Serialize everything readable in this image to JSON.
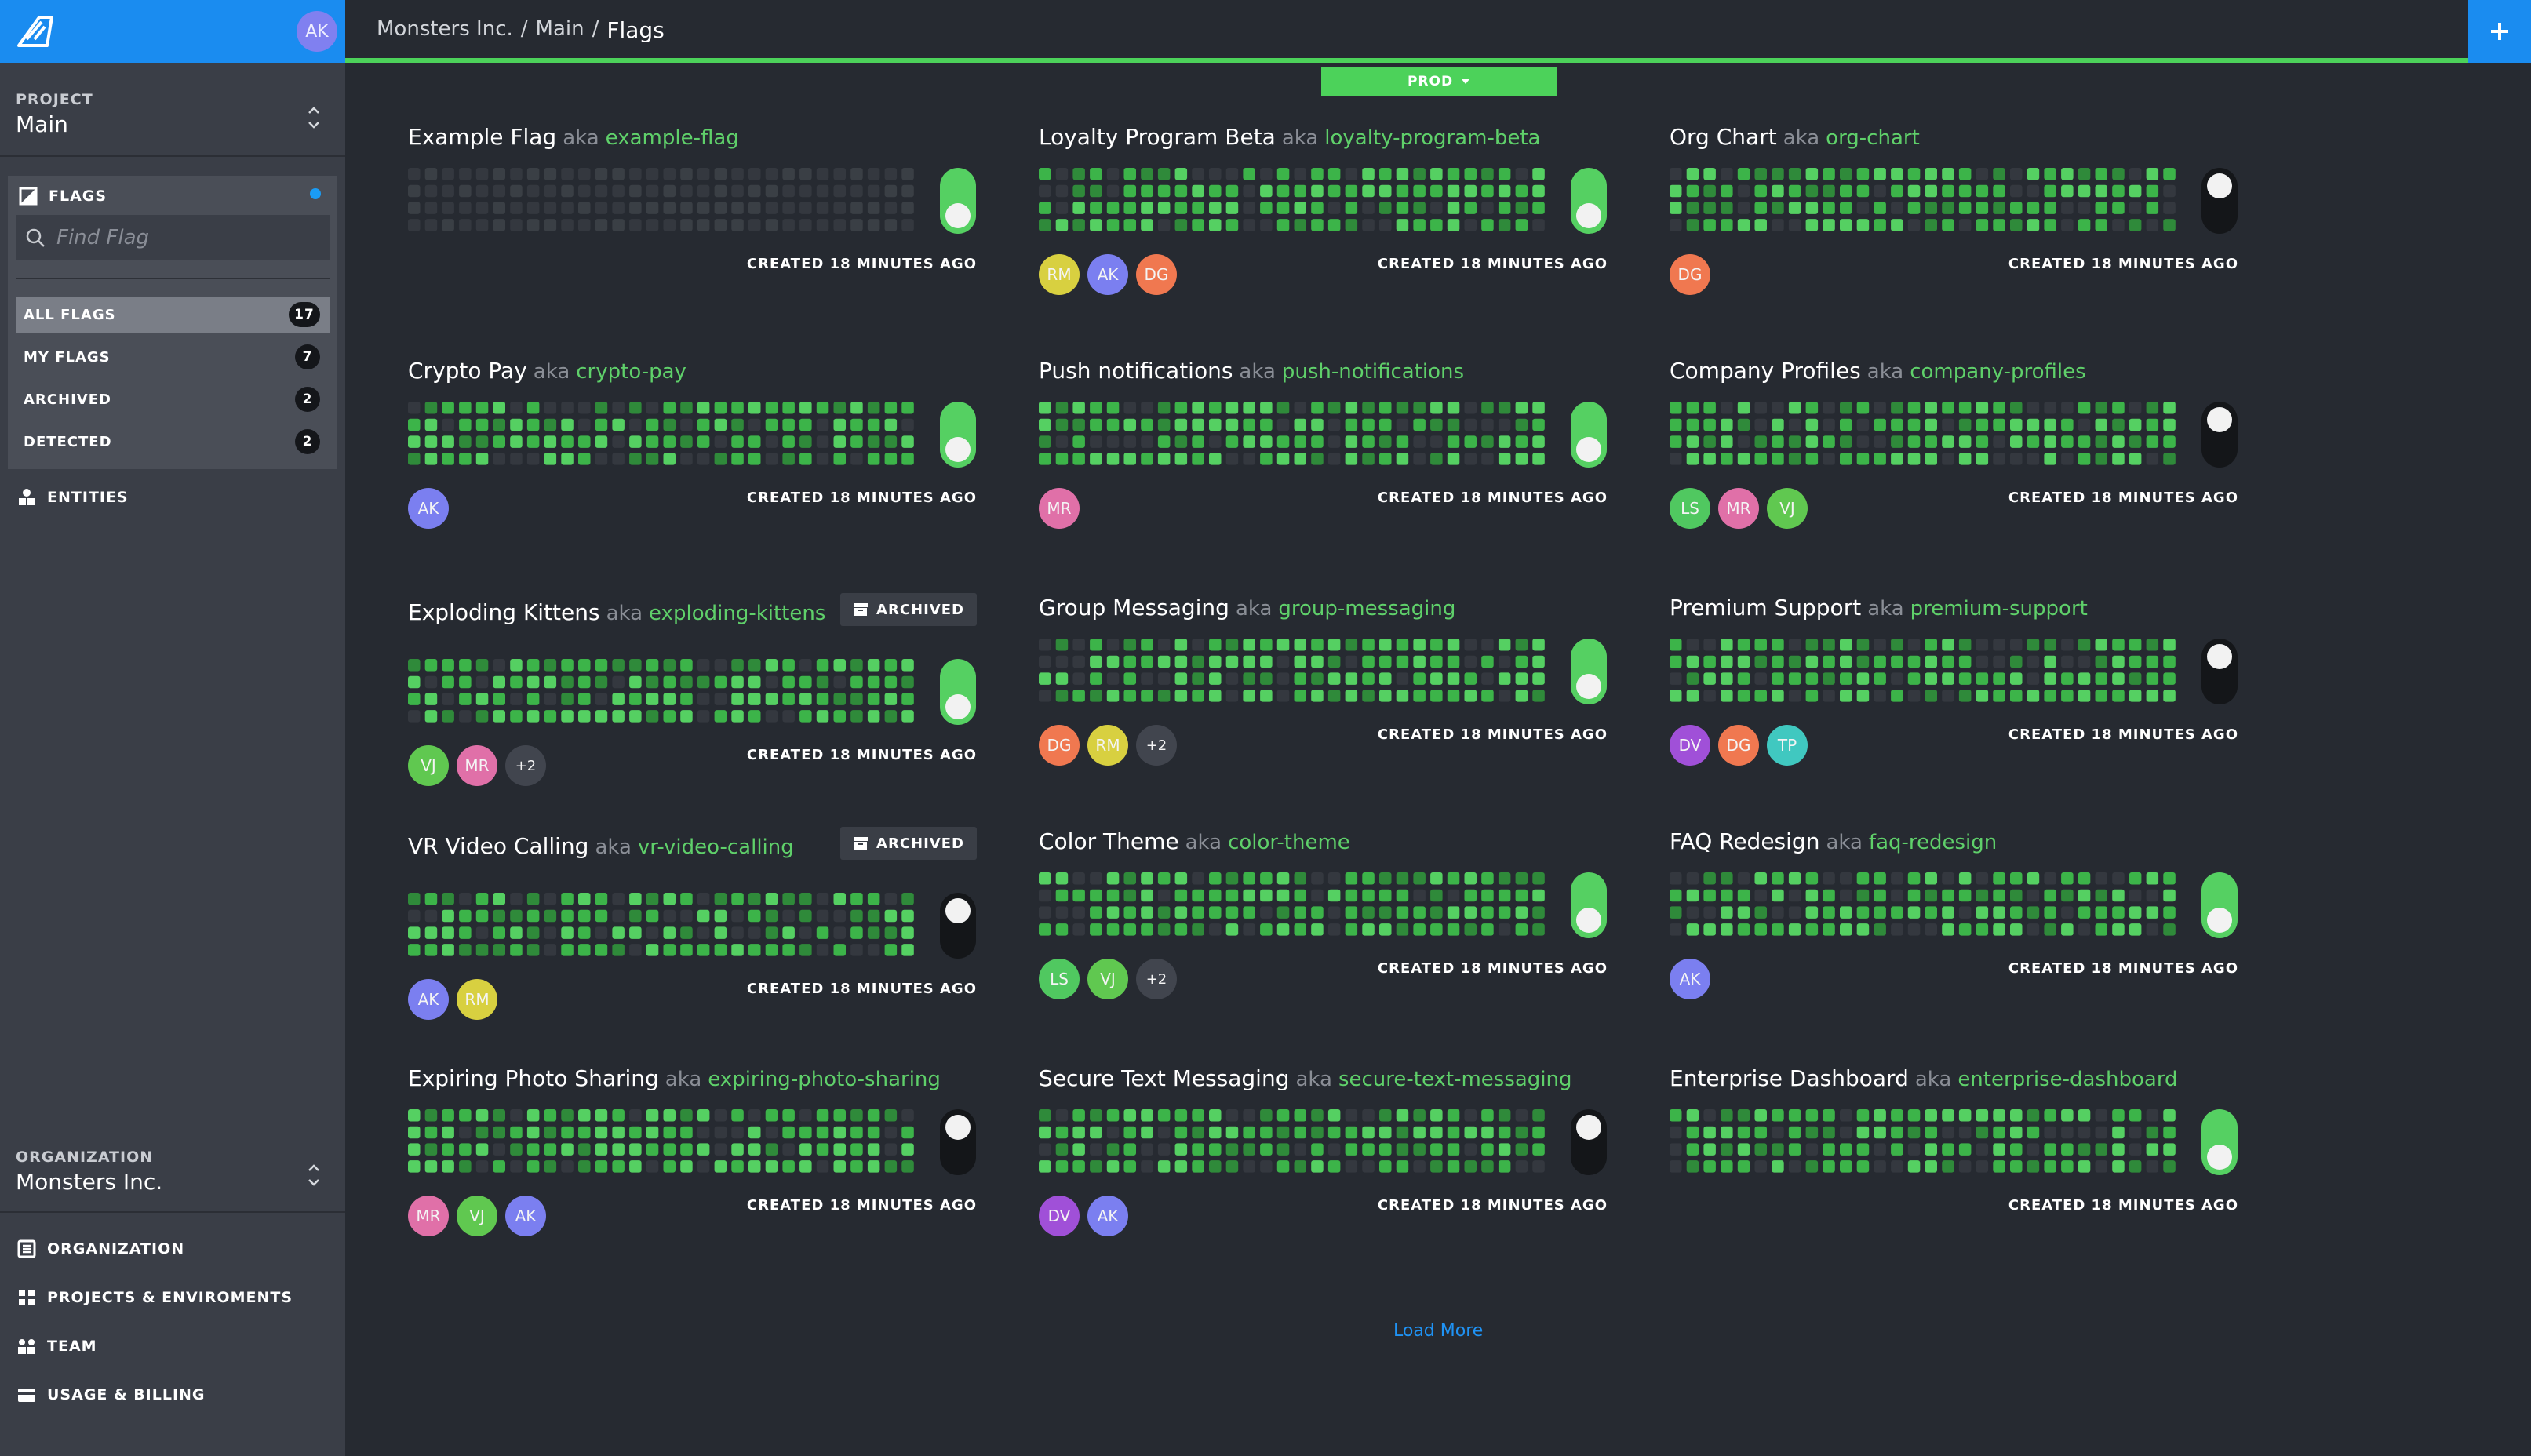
{
  "app": {
    "user_initials": "AK"
  },
  "sidebar": {
    "project_label": "PROJECT",
    "project_name": "Main",
    "flags_title": "FLAGS",
    "search_placeholder": "Find Flag",
    "nav": [
      {
        "label": "ALL FLAGS",
        "count": "17",
        "active": true
      },
      {
        "label": "MY FLAGS",
        "count": "7"
      },
      {
        "label": "ARCHIVED",
        "count": "2"
      },
      {
        "label": "DETECTED",
        "count": "2"
      }
    ],
    "entities_label": "ENTITIES",
    "organization_label": "ORGANIZATION",
    "organization_name": "Monsters Inc.",
    "org_links": [
      "ORGANIZATION",
      "PROJECTS & ENVIROMENTS",
      "TEAM",
      "USAGE & BILLING"
    ]
  },
  "header": {
    "breadcrumb": [
      "Monsters Inc.",
      "/",
      "Main",
      "/",
      "Flags"
    ],
    "environment": "PROD"
  },
  "flags": [
    {
      "name": "Example Flag",
      "key": "example-flag",
      "enabled": true,
      "archived": false,
      "created": "CREATED 18 MINUTES AGO",
      "avatars": [],
      "activity": "none"
    },
    {
      "name": "Loyalty Program Beta",
      "key": "loyalty-program-beta",
      "enabled": true,
      "archived": false,
      "created": "CREATED 18 MINUTES AGO",
      "avatars": [
        "RM",
        "AK",
        "DG"
      ],
      "activity": "high"
    },
    {
      "name": "Org Chart",
      "key": "org-chart",
      "enabled": false,
      "archived": false,
      "created": "CREATED 18 MINUTES AGO",
      "avatars": [
        "DG"
      ],
      "activity": "high"
    },
    {
      "name": "Crypto Pay",
      "key": "crypto-pay",
      "enabled": true,
      "archived": false,
      "created": "CREATED 18 MINUTES AGO",
      "avatars": [
        "AK"
      ],
      "activity": "high"
    },
    {
      "name": "Push notifications",
      "key": "push-notifications",
      "enabled": true,
      "archived": false,
      "created": "CREATED 18 MINUTES AGO",
      "avatars": [
        "MR"
      ],
      "activity": "high"
    },
    {
      "name": "Company Profiles",
      "key": "company-profiles",
      "enabled": false,
      "archived": false,
      "created": "CREATED 18 MINUTES AGO",
      "avatars": [
        "LS",
        "MR",
        "VJ"
      ],
      "activity": "high"
    },
    {
      "name": "Exploding Kittens",
      "key": "exploding-kittens",
      "enabled": true,
      "archived": true,
      "archived_label": "ARCHIVED",
      "created": "CREATED 18 MINUTES AGO",
      "avatars": [
        "VJ",
        "MR"
      ],
      "more": "+2",
      "activity": "high"
    },
    {
      "name": "Group Messaging",
      "key": "group-messaging",
      "enabled": true,
      "archived": false,
      "created": "CREATED 18 MINUTES AGO",
      "avatars": [
        "DG",
        "RM"
      ],
      "more": "+2",
      "activity": "high"
    },
    {
      "name": "Premium Support",
      "key": "premium-support",
      "enabled": false,
      "archived": false,
      "created": "CREATED 18 MINUTES AGO",
      "avatars": [
        "DV",
        "DG",
        "TP"
      ],
      "activity": "high"
    },
    {
      "name": "VR Video Calling",
      "key": "vr-video-calling",
      "enabled": false,
      "archived": true,
      "archived_label": "ARCHIVED",
      "created": "CREATED 18 MINUTES AGO",
      "avatars": [
        "AK",
        "RM"
      ],
      "activity": "high"
    },
    {
      "name": "Color Theme",
      "key": "color-theme",
      "enabled": true,
      "archived": false,
      "created": "CREATED 18 MINUTES AGO",
      "avatars": [
        "LS",
        "VJ"
      ],
      "more": "+2",
      "activity": "high"
    },
    {
      "name": "FAQ Redesign",
      "key": "faq-redesign",
      "enabled": true,
      "archived": false,
      "created": "CREATED 18 MINUTES AGO",
      "avatars": [
        "AK"
      ],
      "activity": "high"
    },
    {
      "name": "Expiring Photo Sharing",
      "key": "expiring-photo-sharing",
      "enabled": false,
      "archived": false,
      "created": "CREATED 18 MINUTES AGO",
      "avatars": [
        "MR",
        "VJ",
        "AK"
      ],
      "activity": "high"
    },
    {
      "name": "Secure Text Messaging",
      "key": "secure-text-messaging",
      "enabled": false,
      "archived": false,
      "created": "CREATED 18 MINUTES AGO",
      "avatars": [
        "DV",
        "AK"
      ],
      "activity": "high"
    },
    {
      "name": "Enterprise Dashboard",
      "key": "enterprise-dashboard",
      "enabled": true,
      "archived": false,
      "created": "CREATED 18 MINUTES AGO",
      "avatars": [],
      "activity": "high"
    }
  ],
  "aka_label": "aka",
  "avatar_colors": {
    "AK": "#7b7ff0",
    "RM": "#d8d040",
    "DG": "#f07850",
    "MR": "#e070a8",
    "LS": "#50c860",
    "VJ": "#60c850",
    "DV": "#a050d8",
    "TP": "#40c8c0"
  },
  "load_more": "Load More",
  "colors": {
    "accent": "#1a8cf0",
    "green": "#4cd25a",
    "background": "#262a31",
    "sidebar": "#3a3e47"
  }
}
